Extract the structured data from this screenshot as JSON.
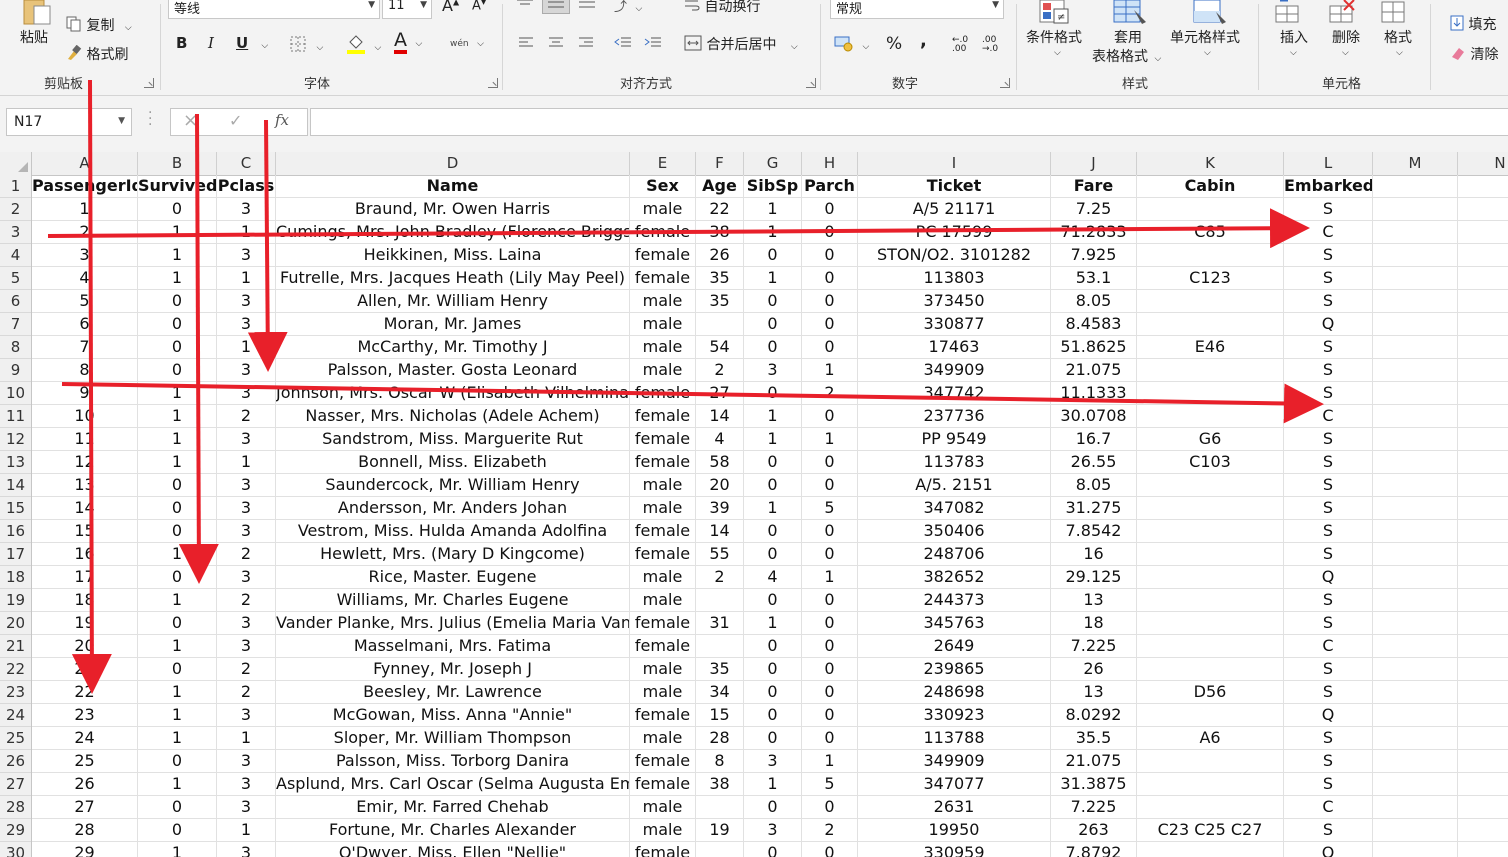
{
  "ribbon": {
    "clipboard": {
      "paste": "粘贴",
      "copy": "复制",
      "format_painter": "格式刷",
      "label": "剪贴板"
    },
    "font": {
      "font_name": "等线",
      "font_size": "11",
      "bold": "B",
      "italic": "I",
      "underline": "U",
      "font_color_glyph": "A",
      "phonetic": "wén",
      "label": "字体"
    },
    "alignment": {
      "wrap_text": "自动换行",
      "merge_center": "合并后居中",
      "label": "对齐方式"
    },
    "number": {
      "format": "常规",
      "percent": "%",
      "comma": ",",
      "label": "数字"
    },
    "styles": {
      "conditional": "条件格式",
      "table_format_1": "套用",
      "table_format_2": "表格格式",
      "cell_styles": "单元格样式",
      "label": "样式"
    },
    "cells": {
      "insert": "插入",
      "delete": "删除",
      "format": "格式",
      "label": "单元格"
    },
    "editing": {
      "fill": "填充",
      "clear": "清除"
    }
  },
  "formula_bar": {
    "name_box": "N17",
    "fx": "fx",
    "cancel": "×",
    "confirm": "✓",
    "content": ""
  },
  "columns": [
    "A",
    "B",
    "C",
    "D",
    "E",
    "F",
    "G",
    "H",
    "I",
    "J",
    "K",
    "L",
    "M",
    "N"
  ],
  "rows": [
    [
      "PassengerId",
      "Survived",
      "Pclass",
      "Name",
      "Sex",
      "Age",
      "SibSp",
      "Parch",
      "Ticket",
      "Fare",
      "Cabin",
      "Embarked",
      "",
      ""
    ],
    [
      "1",
      "0",
      "3",
      "Braund, Mr. Owen Harris",
      "male",
      "22",
      "1",
      "0",
      "A/5 21171",
      "7.25",
      "",
      "S",
      "",
      ""
    ],
    [
      "2",
      "1",
      "1",
      "Cumings, Mrs. John Bradley (Florence Briggs Thayer)",
      "female",
      "38",
      "1",
      "0",
      "PC 17599",
      "71.2833",
      "C85",
      "C",
      "",
      ""
    ],
    [
      "3",
      "1",
      "3",
      "Heikkinen, Miss. Laina",
      "female",
      "26",
      "0",
      "0",
      "STON/O2. 3101282",
      "7.925",
      "",
      "S",
      "",
      ""
    ],
    [
      "4",
      "1",
      "1",
      "Futrelle, Mrs. Jacques Heath (Lily May Peel)",
      "female",
      "35",
      "1",
      "0",
      "113803",
      "53.1",
      "C123",
      "S",
      "",
      ""
    ],
    [
      "5",
      "0",
      "3",
      "Allen, Mr. William Henry",
      "male",
      "35",
      "0",
      "0",
      "373450",
      "8.05",
      "",
      "S",
      "",
      ""
    ],
    [
      "6",
      "0",
      "3",
      "Moran, Mr. James",
      "male",
      "",
      "0",
      "0",
      "330877",
      "8.4583",
      "",
      "Q",
      "",
      ""
    ],
    [
      "7",
      "0",
      "1",
      "McCarthy, Mr. Timothy J",
      "male",
      "54",
      "0",
      "0",
      "17463",
      "51.8625",
      "E46",
      "S",
      "",
      ""
    ],
    [
      "8",
      "0",
      "3",
      "Palsson, Master. Gosta Leonard",
      "male",
      "2",
      "3",
      "1",
      "349909",
      "21.075",
      "",
      "S",
      "",
      ""
    ],
    [
      "9",
      "1",
      "3",
      "Johnson, Mrs. Oscar W (Elisabeth Vilhelmina Berg)",
      "female",
      "27",
      "0",
      "2",
      "347742",
      "11.1333",
      "",
      "S",
      "",
      ""
    ],
    [
      "10",
      "1",
      "2",
      "Nasser, Mrs. Nicholas (Adele Achem)",
      "female",
      "14",
      "1",
      "0",
      "237736",
      "30.0708",
      "",
      "C",
      "",
      ""
    ],
    [
      "11",
      "1",
      "3",
      "Sandstrom, Miss. Marguerite Rut",
      "female",
      "4",
      "1",
      "1",
      "PP 9549",
      "16.7",
      "G6",
      "S",
      "",
      ""
    ],
    [
      "12",
      "1",
      "1",
      "Bonnell, Miss. Elizabeth",
      "female",
      "58",
      "0",
      "0",
      "113783",
      "26.55",
      "C103",
      "S",
      "",
      ""
    ],
    [
      "13",
      "0",
      "3",
      "Saundercock, Mr. William Henry",
      "male",
      "20",
      "0",
      "0",
      "A/5. 2151",
      "8.05",
      "",
      "S",
      "",
      ""
    ],
    [
      "14",
      "0",
      "3",
      "Andersson, Mr. Anders Johan",
      "male",
      "39",
      "1",
      "5",
      "347082",
      "31.275",
      "",
      "S",
      "",
      ""
    ],
    [
      "15",
      "0",
      "3",
      "Vestrom, Miss. Hulda Amanda Adolfina",
      "female",
      "14",
      "0",
      "0",
      "350406",
      "7.8542",
      "",
      "S",
      "",
      ""
    ],
    [
      "16",
      "1",
      "2",
      "Hewlett, Mrs. (Mary D Kingcome)",
      "female",
      "55",
      "0",
      "0",
      "248706",
      "16",
      "",
      "S",
      "",
      ""
    ],
    [
      "17",
      "0",
      "3",
      "Rice, Master. Eugene",
      "male",
      "2",
      "4",
      "1",
      "382652",
      "29.125",
      "",
      "Q",
      "",
      ""
    ],
    [
      "18",
      "1",
      "2",
      "Williams, Mr. Charles Eugene",
      "male",
      "",
      "0",
      "0",
      "244373",
      "13",
      "",
      "S",
      "",
      ""
    ],
    [
      "19",
      "0",
      "3",
      "Vander Planke, Mrs. Julius (Emelia Maria Vandemoortele)",
      "female",
      "31",
      "1",
      "0",
      "345763",
      "18",
      "",
      "S",
      "",
      ""
    ],
    [
      "20",
      "1",
      "3",
      "Masselmani, Mrs. Fatima",
      "female",
      "",
      "0",
      "0",
      "2649",
      "7.225",
      "",
      "C",
      "",
      ""
    ],
    [
      "21",
      "0",
      "2",
      "Fynney, Mr. Joseph J",
      "male",
      "35",
      "0",
      "0",
      "239865",
      "26",
      "",
      "S",
      "",
      ""
    ],
    [
      "22",
      "1",
      "2",
      "Beesley, Mr. Lawrence",
      "male",
      "34",
      "0",
      "0",
      "248698",
      "13",
      "D56",
      "S",
      "",
      ""
    ],
    [
      "23",
      "1",
      "3",
      "McGowan, Miss. Anna \"Annie\"",
      "female",
      "15",
      "0",
      "0",
      "330923",
      "8.0292",
      "",
      "Q",
      "",
      ""
    ],
    [
      "24",
      "1",
      "1",
      "Sloper, Mr. William Thompson",
      "male",
      "28",
      "0",
      "0",
      "113788",
      "35.5",
      "A6",
      "S",
      "",
      ""
    ],
    [
      "25",
      "0",
      "3",
      "Palsson, Miss. Torborg Danira",
      "female",
      "8",
      "3",
      "1",
      "349909",
      "21.075",
      "",
      "S",
      "",
      ""
    ],
    [
      "26",
      "1",
      "3",
      "Asplund, Mrs. Carl Oscar (Selma Augusta Emilia Johansson)",
      "female",
      "38",
      "1",
      "5",
      "347077",
      "31.3875",
      "",
      "S",
      "",
      ""
    ],
    [
      "27",
      "0",
      "3",
      "Emir, Mr. Farred Chehab",
      "male",
      "",
      "0",
      "0",
      "2631",
      "7.225",
      "",
      "C",
      "",
      ""
    ],
    [
      "28",
      "0",
      "1",
      "Fortune, Mr. Charles Alexander",
      "male",
      "19",
      "3",
      "2",
      "19950",
      "263",
      "C23 C25 C27",
      "S",
      "",
      ""
    ],
    [
      "29",
      "1",
      "3",
      "O'Dwyer, Miss. Ellen \"Nellie\"",
      "female",
      "",
      "0",
      "0",
      "330959",
      "7.8792",
      "",
      "Q",
      "",
      ""
    ]
  ],
  "colors": {
    "arrow": "#e8202a",
    "grid_line": "#e1e1e1",
    "header_bg": "#f0f0f0"
  }
}
